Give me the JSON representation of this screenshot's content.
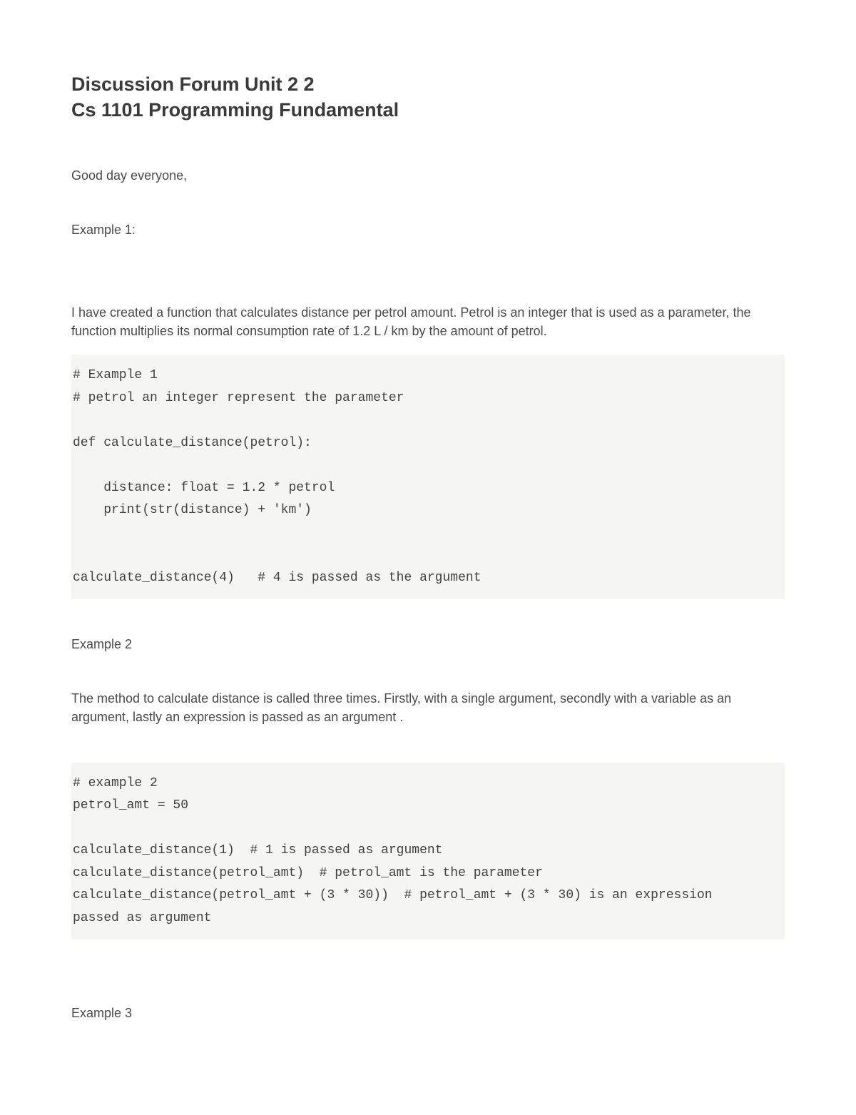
{
  "heading": {
    "line1": "Discussion Forum Unit 2 2",
    "line2": "Cs 1101 Programming Fundamental"
  },
  "greeting": "Good day everyone,",
  "example1": {
    "label": "Example 1:",
    "description": "I have created a function that calculates distance per petrol amount. Petrol is an integer that is used as a parameter, the function multiplies its normal consumption rate of 1.2 L / km by the amount of petrol.",
    "code": "# Example 1\n# petrol an integer represent the parameter\n\ndef calculate_distance(petrol):\n\n    distance: float = 1.2 * petrol\n    print(str(distance) + 'km')\n\n\ncalculate_distance(4)   # 4 is passed as the argument"
  },
  "example2": {
    "label": "Example 2",
    "description": "The method to calculate distance is called three times. Firstly, with a single argument, secondly with a variable as an argument, lastly an expression is passed as an argument .",
    "code": "# example 2\npetrol_amt = 50\n\ncalculate_distance(1)  # 1 is passed as argument\ncalculate_distance(petrol_amt)  # petrol_amt is the parameter\ncalculate_distance(petrol_amt + (3 * 30))  # petrol_amt + (3 * 30) is an expression\npassed as argument"
  },
  "example3": {
    "label": "Example 3"
  }
}
